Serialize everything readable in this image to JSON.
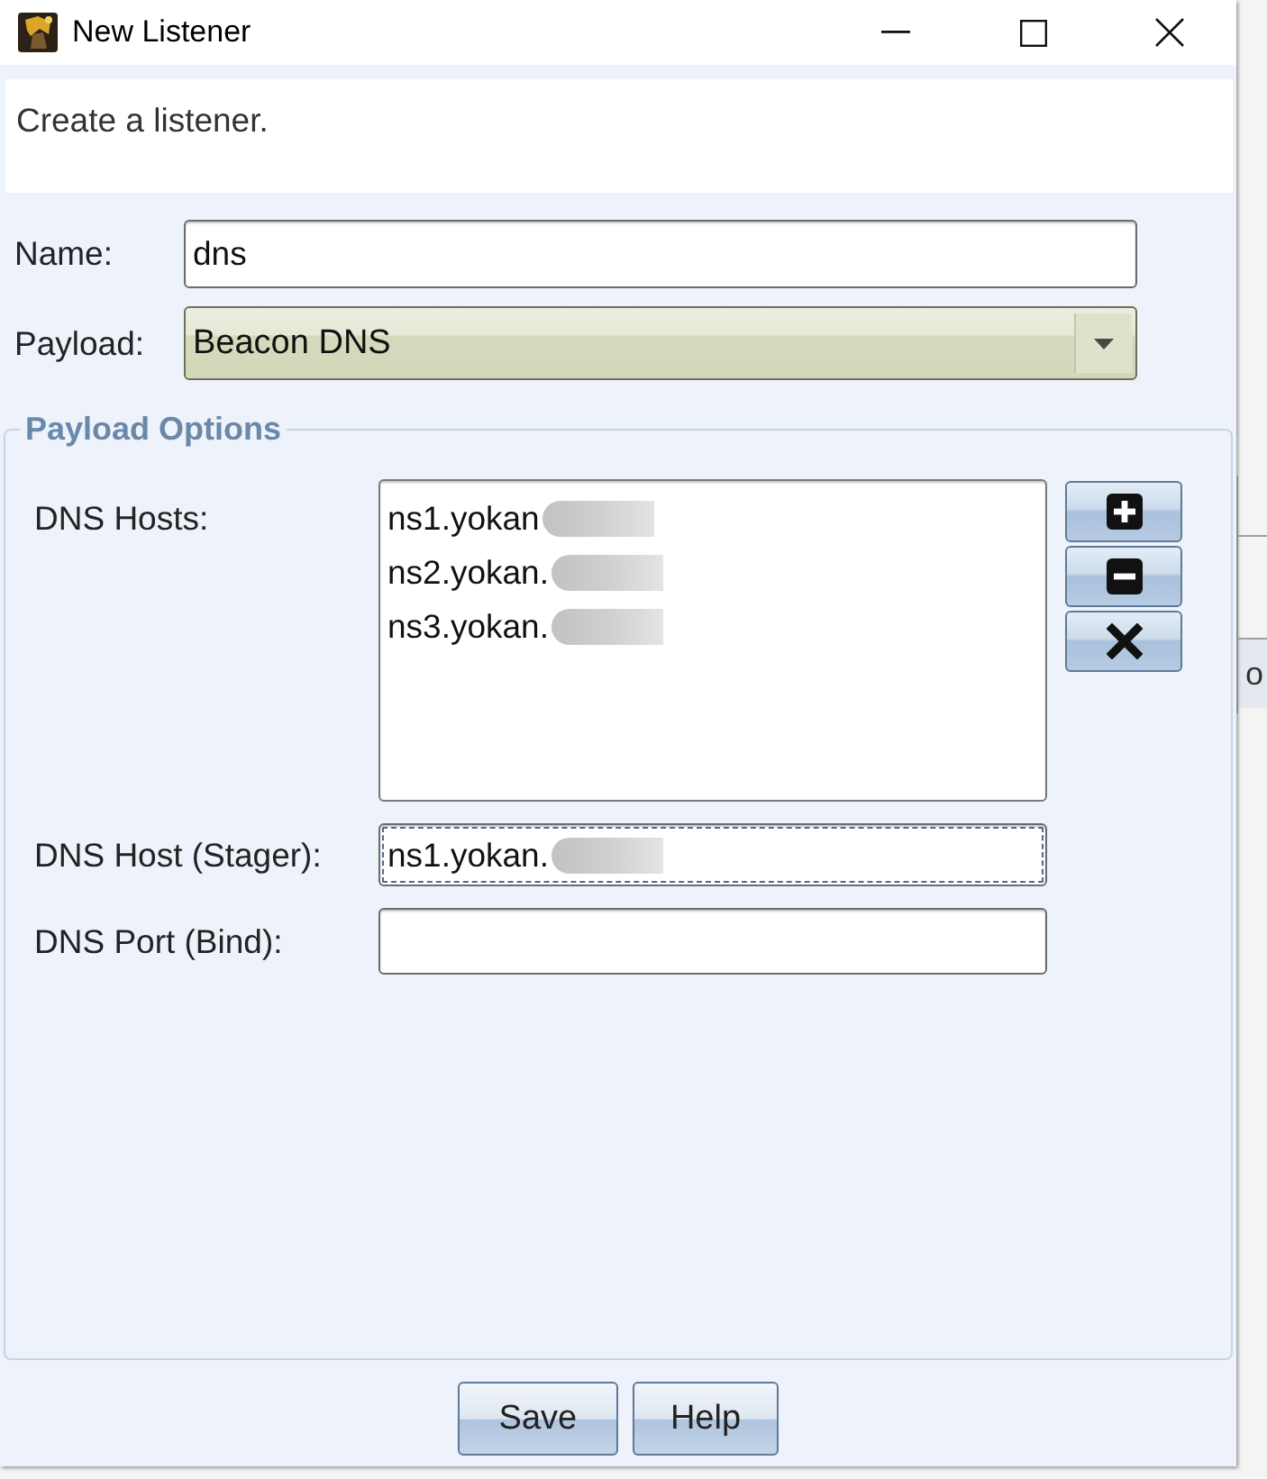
{
  "window": {
    "title": "New Listener"
  },
  "description": "Create a listener.",
  "form": {
    "fields": [
      {
        "kind": "text",
        "label": "Name:",
        "value": "dns",
        "focused": false
      },
      {
        "kind": "combo",
        "label": "Payload:",
        "value": "Beacon DNS"
      }
    ]
  },
  "payload_options": {
    "title": "Payload Options",
    "fields": [
      {
        "kind": "list",
        "label": "DNS Hosts:",
        "items": [
          {
            "text": "ns1.yokan",
            "redacted": true
          },
          {
            "text": "ns2.yokan.",
            "redacted": true
          },
          {
            "text": "ns3.yokan.",
            "redacted": true
          }
        ],
        "list_buttons": [
          {
            "kind": "add"
          },
          {
            "kind": "remove"
          },
          {
            "kind": "clear"
          }
        ]
      },
      {
        "kind": "text",
        "label": "DNS Host (Stager):",
        "value": "ns1.yokan.",
        "redacted": true,
        "focused": true
      },
      {
        "kind": "text",
        "label": "DNS Port (Bind):",
        "focused": false
      }
    ]
  },
  "buttons": [
    "Save",
    "Help"
  ],
  "background_window": {
    "text": "o"
  }
}
